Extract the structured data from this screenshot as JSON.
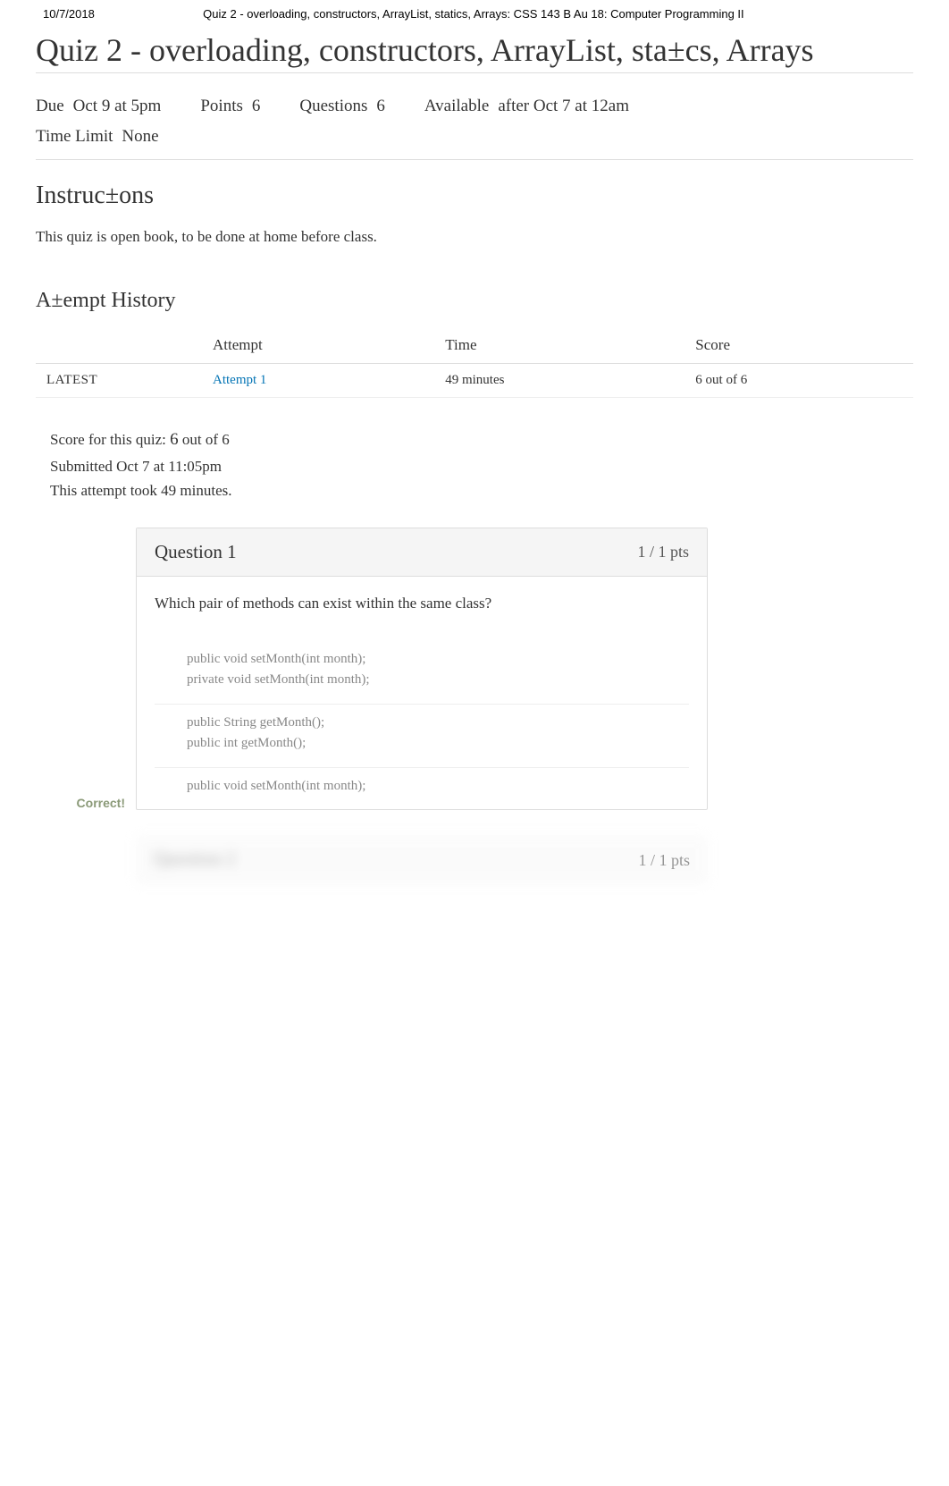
{
  "header": {
    "date": "10/7/2018",
    "breadcrumb": "Quiz 2 - overloading, constructors, ArrayList, statics, Arrays: CSS 143 B Au 18: Computer Programming II"
  },
  "page_title": "Quiz 2 - overloading, constructors, ArrayList, sta±cs, Arrays",
  "meta": {
    "due_label": "Due",
    "due_value": "Oct 9 at 5pm",
    "points_label": "Points",
    "points_value": "6",
    "questions_label": "Questions",
    "questions_value": "6",
    "available_label": "Available",
    "available_value": "after Oct 7 at 12am",
    "timelimit_label": "Time Limit",
    "timelimit_value": "None"
  },
  "instructions": {
    "title": "Instruc±ons",
    "body": "This quiz is open book, to be done at home before class."
  },
  "attempt_history": {
    "title": "A±empt History",
    "columns": {
      "blank": "",
      "attempt": "Attempt",
      "time": "Time",
      "score": "Score"
    },
    "rows": [
      {
        "latest": "LATEST",
        "attempt": "Attempt 1",
        "time": "49 minutes",
        "score": "6 out of 6"
      }
    ]
  },
  "score_block": {
    "score_label": "Score for this quiz: ",
    "score_value": "6",
    "score_suffix": " out of 6",
    "submitted": "Submitted Oct 7 at 11:05pm",
    "took": "This attempt took 49 minutes."
  },
  "questions": [
    {
      "sidebar_label": "Correct!",
      "title": "Question 1",
      "pts": "1 / 1 pts",
      "text": "Which pair of methods can exist within the same class?",
      "options": [
        {
          "lines": [
            "public void setMonth(int month);",
            "private void setMonth(int month);"
          ]
        },
        {
          "lines": [
            "public String getMonth();",
            "public int getMonth();"
          ]
        },
        {
          "lines": [
            "public void setMonth(int month);"
          ],
          "cut": true
        }
      ]
    },
    {
      "blurred": true,
      "title": "Question 2",
      "pts": "1 / 1 pts"
    }
  ]
}
